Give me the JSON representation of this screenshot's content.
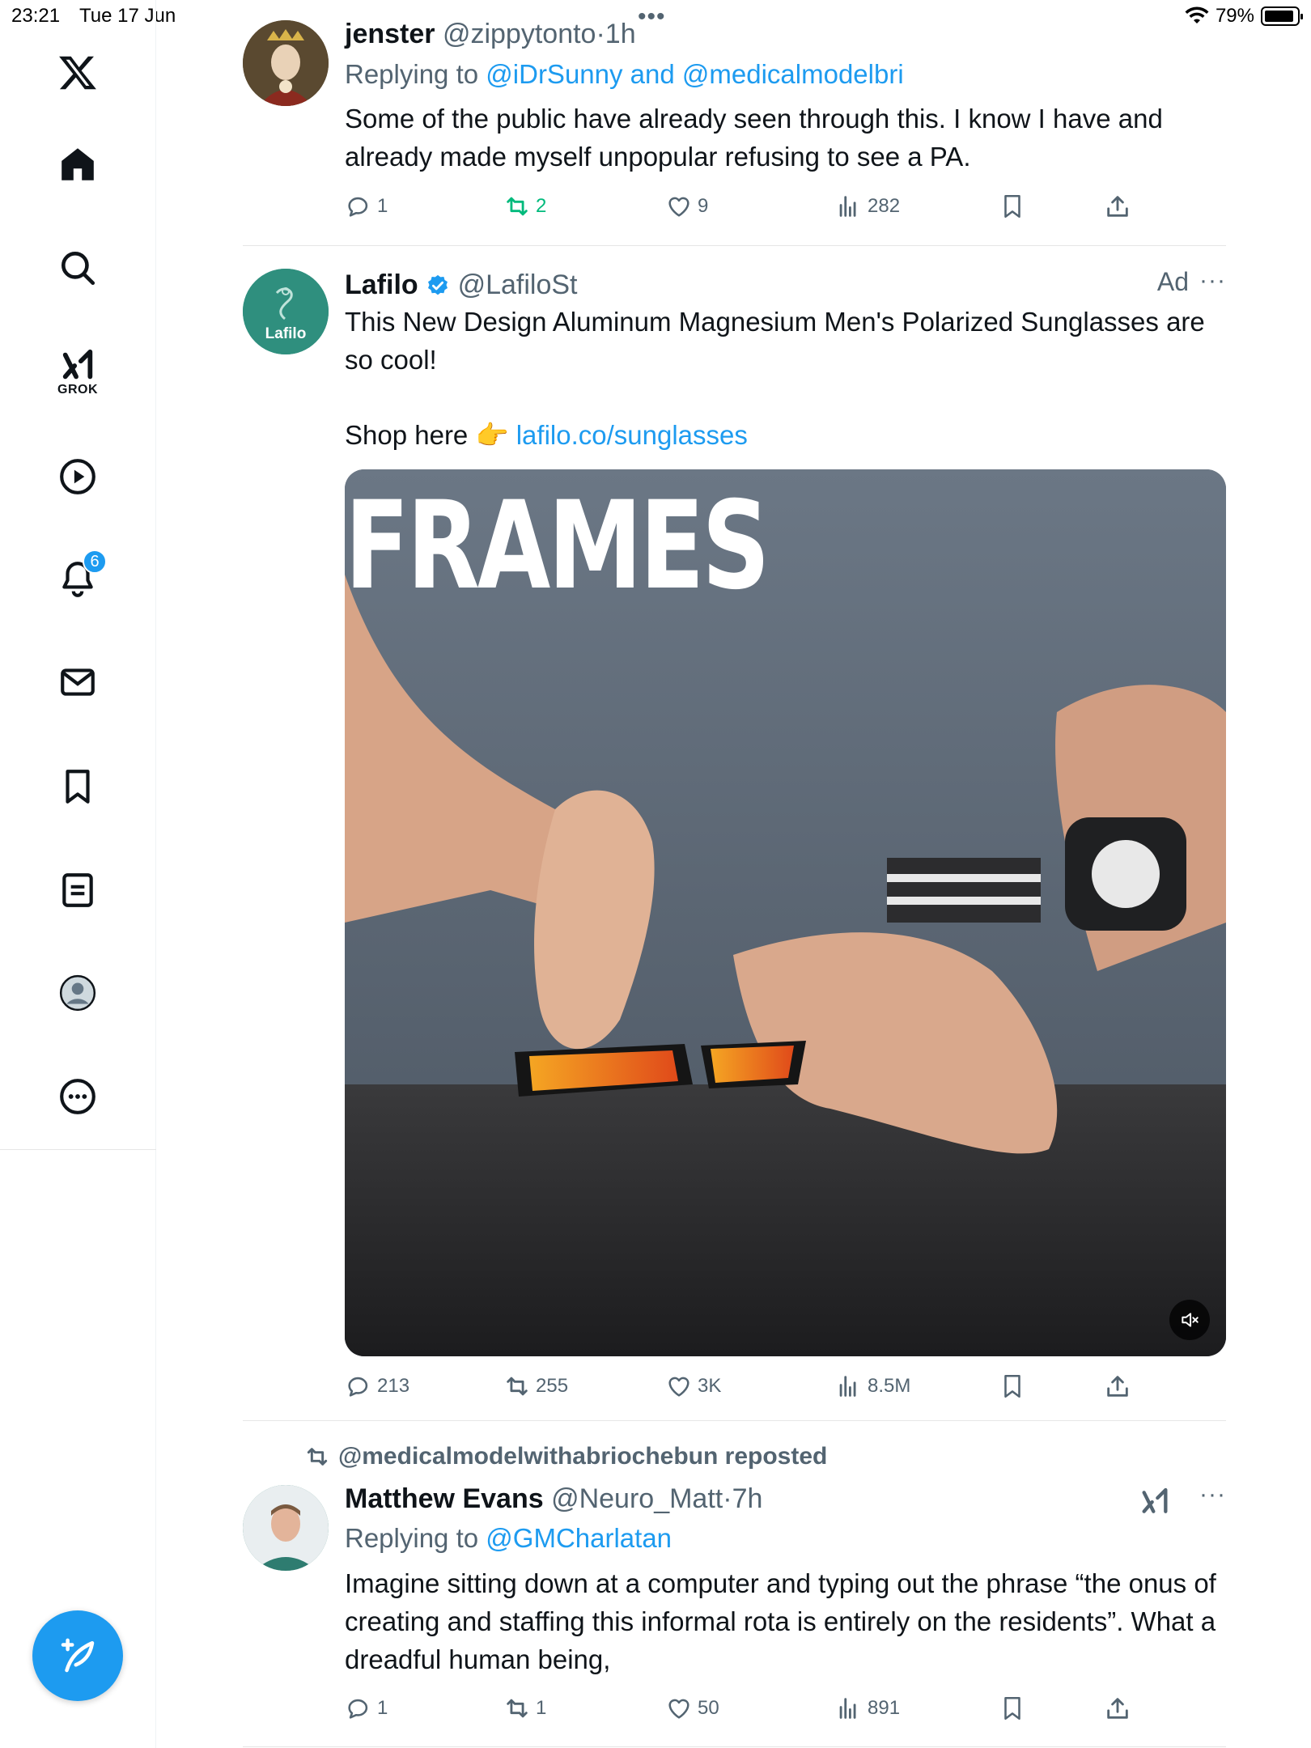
{
  "status_bar": {
    "time": "23:21",
    "date": "Tue 17 Jun",
    "battery": "79%",
    "battery_level": 0.79
  },
  "sidebar": {
    "items": [
      {
        "icon": "x-logo-icon"
      },
      {
        "icon": "home-icon"
      },
      {
        "icon": "search-icon"
      },
      {
        "icon": "grok-icon",
        "label": "GROK"
      },
      {
        "icon": "video-icon"
      },
      {
        "icon": "notifications-icon",
        "badge": "6"
      },
      {
        "icon": "messages-icon"
      },
      {
        "icon": "bookmarks-icon"
      },
      {
        "icon": "lists-icon"
      },
      {
        "icon": "profile-icon"
      },
      {
        "icon": "more-icon"
      }
    ],
    "compose_icon": "compose-icon"
  },
  "tweets": [
    {
      "name": "jenster",
      "handle": "@zippytonto",
      "dot": "·",
      "time": "1h",
      "replying_prefix": "Replying to",
      "replying_to": "@iDrSunny and @medicalmodelbri",
      "text": "Some of the public have already seen through this. I know I have and already made myself unpopular refusing to see a PA.",
      "replies": "1",
      "reposts": "2",
      "likes": "9",
      "views": "282"
    },
    {
      "name": "Lafilo",
      "handle": "@LafiloSt",
      "ad": "Ad",
      "avatar_text": "Lafilo",
      "text": "This New Design Aluminum Magnesium Men's Polarized Sunglasses are so cool!",
      "shop_text": "Shop here 👉",
      "shop_link": "lafilo.co/sunglasses",
      "media_caption": "FRAMES",
      "replies": "213",
      "reposts": "255",
      "likes": "3K",
      "views": "8.5M"
    },
    {
      "reposted_by": "@medicalmodelwithabriochebun reposted",
      "name": "Matthew Evans",
      "handle": "@Neuro_Matt",
      "dot": "·",
      "time": "7h",
      "replying_prefix": "Replying to",
      "replying_to": "@GMCharlatan",
      "text": "Imagine sitting down at a computer and typing out the phrase “the onus of creating and staffing this informal rota is entirely on the residents”. What a dreadful human being,",
      "replies": "1",
      "reposts": "1",
      "likes": "50",
      "views": "891"
    }
  ],
  "colors": {
    "accent": "#1d9bf0",
    "repost_active": "#00ba7c",
    "muted": "#536471",
    "text": "#0f1419"
  }
}
